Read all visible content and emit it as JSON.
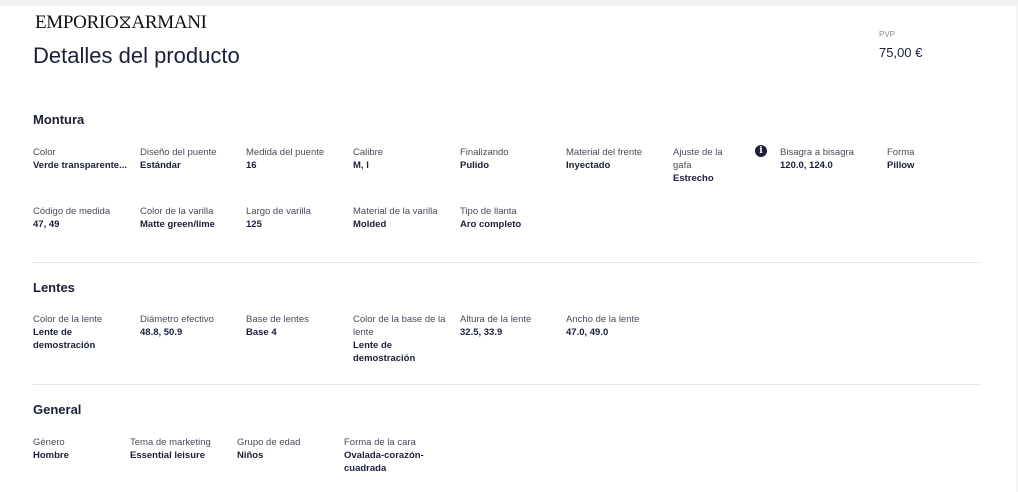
{
  "brand": {
    "logo_text": "EMPORIO⧖ARMANI"
  },
  "page": {
    "title": "Detalles del producto"
  },
  "price": {
    "label": "PVP",
    "value": "75,00 €"
  },
  "sections": {
    "montura": {
      "title": "Montura",
      "attrs": [
        {
          "label": "Color",
          "value": "Verde transparente..."
        },
        {
          "label": "Diseño del puente",
          "value": "Estándar"
        },
        {
          "label": "Medida del puente",
          "value": "16"
        },
        {
          "label": "Calibre",
          "value": "M, l"
        },
        {
          "label": "Finalizando",
          "value": "Pulido"
        },
        {
          "label": "Material del frente",
          "value": "Inyectado"
        },
        {
          "label": "Ajuste de la gafa",
          "value": "Estrecho"
        },
        {
          "label": "Bisagra a bisagra",
          "value": "120.0, 124.0"
        },
        {
          "label": "Forma",
          "value": "Pillow"
        },
        {
          "label": "Código de medida",
          "value": "47, 49"
        },
        {
          "label": "Color de la varilla",
          "value": "Matte green/lime"
        },
        {
          "label": "Largo de varilla",
          "value": "125"
        },
        {
          "label": "Material de la varilla",
          "value": "Molded"
        },
        {
          "label": "Tipo de llanta",
          "value": "Aro completo"
        }
      ]
    },
    "lentes": {
      "title": "Lentes",
      "attrs": [
        {
          "label": "Color de la lente",
          "value": "Lente de demostración"
        },
        {
          "label": "Diámetro efectivo",
          "value": "48.8, 50.9"
        },
        {
          "label": "Base de lentes",
          "value": "Base 4"
        },
        {
          "label": "Color de la base de la lente",
          "value": "Lente de demostración"
        },
        {
          "label": "Altura de la lente",
          "value": "32.5, 33.9"
        },
        {
          "label": "Ancho de la lente",
          "value": "47.0, 49.0"
        }
      ]
    },
    "general": {
      "title": "General",
      "attrs": [
        {
          "label": "Género",
          "value": "Hombre"
        },
        {
          "label": "Tema de marketing",
          "value": "Essential leisure"
        },
        {
          "label": "Grupo de edad",
          "value": "Niños"
        },
        {
          "label": "Forma de la cara",
          "value": "Ovalada-corazón-cuadrada"
        }
      ]
    }
  },
  "icons": {
    "info": "info-icon"
  }
}
